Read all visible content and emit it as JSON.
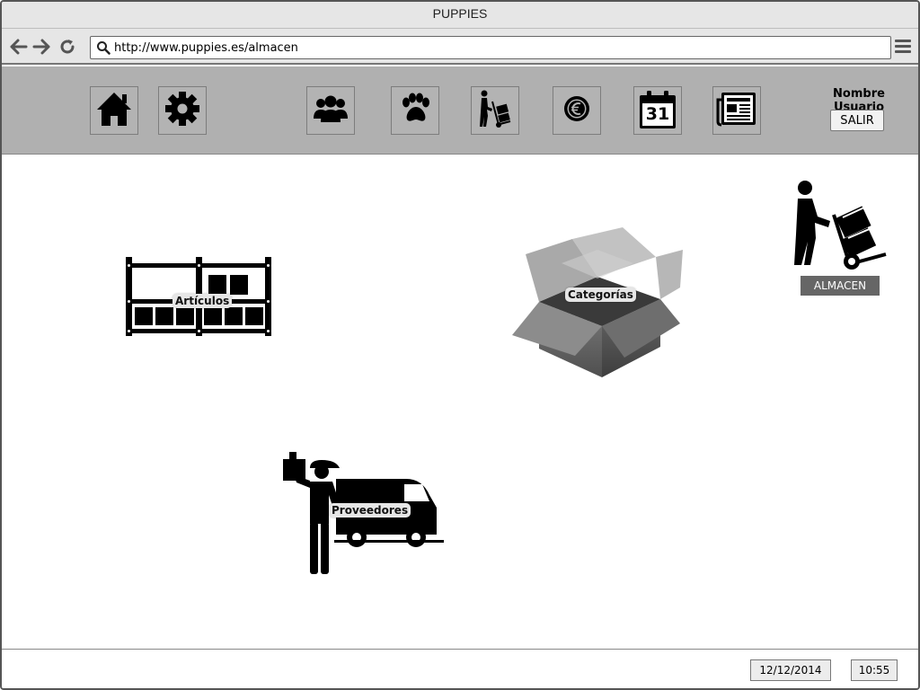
{
  "window": {
    "title": "PUPPIES"
  },
  "addressbar": {
    "url": "http://www.puppies.es/almacen",
    "icons": {
      "back": "arrow-left-icon",
      "forward": "arrow-right-icon",
      "reload": "reload-icon",
      "search": "search-icon",
      "menu": "hamburger-menu-icon"
    }
  },
  "toolbar": {
    "buttons": [
      {
        "id": "home",
        "icon": "house-icon"
      },
      {
        "id": "settings",
        "icon": "gear-icon"
      },
      {
        "id": "users",
        "icon": "people-group-icon"
      },
      {
        "id": "pets",
        "icon": "paw-icon"
      },
      {
        "id": "warehouse",
        "icon": "hand-truck-icon"
      },
      {
        "id": "finance",
        "icon": "euro-coin-icon"
      },
      {
        "id": "calendar",
        "icon": "calendar-icon",
        "label": "31"
      },
      {
        "id": "news",
        "icon": "newspaper-icon"
      }
    ],
    "user_name": "Nombre Usuario",
    "logout_label": "SALIR"
  },
  "main": {
    "section_badge": "ALMACEN",
    "tiles": [
      {
        "id": "articulos",
        "label": "Artículos",
        "icon": "warehouse-shelves-icon"
      },
      {
        "id": "categorias",
        "label": "Categorías",
        "icon": "open-box-icon"
      },
      {
        "id": "proveedores",
        "label": "Proveedores",
        "icon": "delivery-person-van-icon"
      }
    ]
  },
  "status": {
    "date": "12/12/2014",
    "time": "10:55"
  },
  "colors": {
    "toolbar_bg": "#b0b0b0",
    "titlebar_bg": "#e6e6e6",
    "badge_bg": "#666666"
  }
}
